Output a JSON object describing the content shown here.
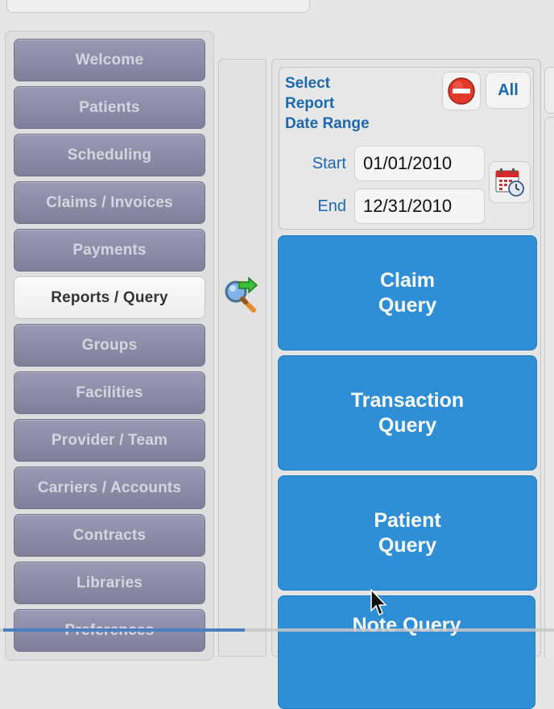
{
  "sidebar": {
    "items": [
      {
        "label": "Welcome",
        "active": false
      },
      {
        "label": "Patients",
        "active": false
      },
      {
        "label": "Scheduling",
        "active": false
      },
      {
        "label": "Claims / Invoices",
        "active": false
      },
      {
        "label": "Payments",
        "active": false
      },
      {
        "label": "Reports / Query",
        "active": true
      },
      {
        "label": "Groups",
        "active": false
      },
      {
        "label": "Facilities",
        "active": false
      },
      {
        "label": "Provider / Team",
        "active": false
      },
      {
        "label": "Carriers / Accounts",
        "active": false
      },
      {
        "label": "Contracts",
        "active": false
      },
      {
        "label": "Libraries",
        "active": false
      },
      {
        "label": "Preferences",
        "active": false
      }
    ]
  },
  "date_range": {
    "title": "Select\nReport\nDate Range",
    "all_label": "All",
    "start_label": "Start",
    "start_value": "01/01/2010",
    "end_label": "End",
    "end_value": "12/31/2010"
  },
  "queries": {
    "claim": "Claim\nQuery",
    "transaction": "Transaction\nQuery",
    "patient": "Patient\nQuery",
    "note": "Note Query"
  },
  "icons": {
    "clear": "no-entry-icon",
    "calendar": "calendar-clock-icon",
    "query": "magnifier-arrow-icon"
  },
  "colors": {
    "nav_inactive": "#8e8ca6",
    "nav_active": "#f7f7f7",
    "accent_text": "#1a68b0",
    "query_button": "#2f8fd6"
  }
}
